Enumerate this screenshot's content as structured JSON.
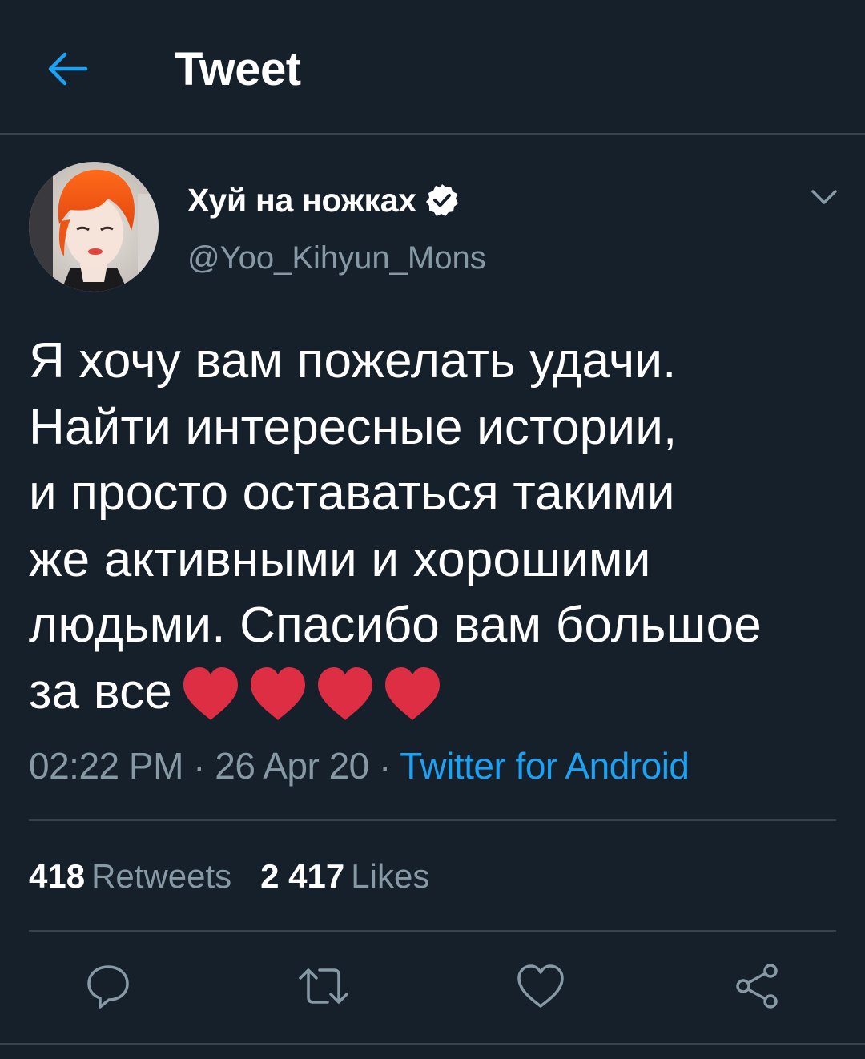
{
  "colors": {
    "background": "#15202b",
    "accent": "#1da1f2",
    "secondary_text": "#8899a6",
    "divider": "#38444d",
    "heart": "#dd2e44"
  },
  "header": {
    "back_icon": "arrow-left-icon",
    "title": "Tweet"
  },
  "author": {
    "display_name": "Хуй на ножках",
    "verified_icon": "verified-badge-icon",
    "handle": "@Yoo_Kihyun_Mons",
    "menu_icon": "chevron-down-icon"
  },
  "tweet": {
    "lines": [
      "Я хочу вам пожелать удачи.",
      "Найти интересные истории,",
      "и просто оставаться такими",
      "же активными и хорошими",
      "людьми. Спасибо вам большое",
      "за все"
    ],
    "emoji": "❤️❤️❤️❤️"
  },
  "meta": {
    "time": "02:22 PM",
    "separator": " · ",
    "date": "26 Apr 20",
    "source": "Twitter for Android"
  },
  "stats": {
    "retweets_count": "418",
    "retweets_label": "Retweets",
    "likes_count": "2 417",
    "likes_label": "Likes"
  },
  "actions": [
    {
      "icon": "reply-icon"
    },
    {
      "icon": "retweet-icon"
    },
    {
      "icon": "like-heart-icon"
    },
    {
      "icon": "share-icon"
    }
  ]
}
